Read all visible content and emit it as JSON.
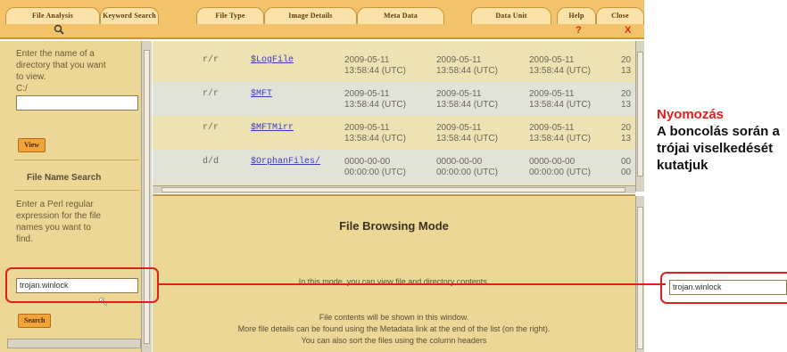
{
  "tabs": [
    {
      "label": "File Analysis"
    },
    {
      "label": "Keyword Search"
    },
    {
      "label": "File Type"
    },
    {
      "label": "Image Details"
    },
    {
      "label": "Meta Data"
    },
    {
      "label": "Data Unit"
    },
    {
      "label": "Help",
      "icon_text": "?"
    },
    {
      "label": "Close",
      "icon_text": "X"
    }
  ],
  "left": {
    "dir_prompt": [
      "Enter the name of a",
      "directory that you want",
      "to view."
    ],
    "dir_path": "C:/",
    "dir_value": "",
    "view_button": "View",
    "name_search_title": "File Name Search",
    "regex_prompt": [
      "Enter a Perl regular",
      "expression for the file",
      "names you want to",
      "find."
    ],
    "search_value": "trojan.winlock",
    "search_button": "Search"
  },
  "file_rows": [
    {
      "mode": "r/r",
      "name": "$LogFile",
      "t1": "2009-05-11",
      "t1b": "13:58:44 (UTC)",
      "t2": "2009-05-11",
      "t2b": "13:58:44 (UTC)",
      "t3": "2009-05-11",
      "t3b": "13:58:44 (UTC)",
      "t4": "20",
      "t4b": "13"
    },
    {
      "mode": "r/r",
      "name": "$MFT",
      "t1": "2009-05-11",
      "t1b": "13:58:44 (UTC)",
      "t2": "2009-05-11",
      "t2b": "13:58:44 (UTC)",
      "t3": "2009-05-11",
      "t3b": "13:58:44 (UTC)",
      "t4": "20",
      "t4b": "13"
    },
    {
      "mode": "r/r",
      "name": "$MFTMirr",
      "t1": "2009-05-11",
      "t1b": "13:58:44 (UTC)",
      "t2": "2009-05-11",
      "t2b": "13:58:44 (UTC)",
      "t3": "2009-05-11",
      "t3b": "13:58:44 (UTC)",
      "t4": "20",
      "t4b": "13"
    },
    {
      "mode": "d/d",
      "name": "$OrphanFiles/",
      "t1": "0000-00-00",
      "t1b": "00:00:00 (UTC)",
      "t2": "0000-00-00",
      "t2b": "00:00:00 (UTC)",
      "t3": "0000-00-00",
      "t3b": "00:00:00 (UTC)",
      "t4": "00",
      "t4b": "00"
    }
  ],
  "content": {
    "title": "File Browsing Mode",
    "line1": "In this mode, you can view file and directory contents.",
    "line2": "File contents will be shown in this window.",
    "line3": "More file details can be found using the Metadata link at the end of the list (on the right).",
    "line4": "You can also sort the files using the column headers"
  },
  "caption": {
    "title": "Nyomozás",
    "body": "A boncolás során a trójai viselkedését kutatjuk"
  },
  "zoom_value": "trojan.winlock",
  "colors": {
    "accent_red": "#e0201c",
    "tabbar": "#f2c36a",
    "panel": "#ecd796",
    "link": "#3b3bbf"
  }
}
